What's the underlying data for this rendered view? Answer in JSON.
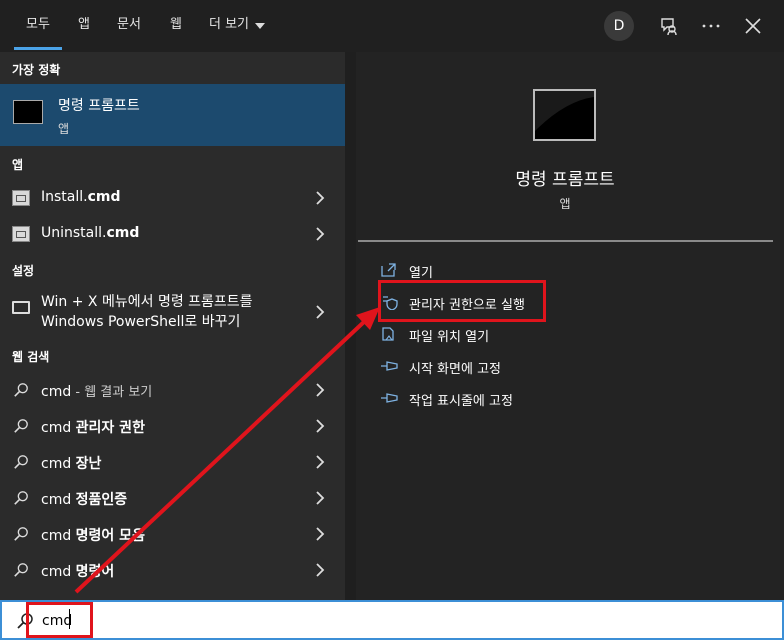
{
  "tabs": [
    {
      "label": "모두",
      "active": true
    },
    {
      "label": "앱"
    },
    {
      "label": "문서"
    },
    {
      "label": "웹"
    },
    {
      "label": "더 보기"
    }
  ],
  "account": {
    "initial": "D"
  },
  "sections": {
    "best_match": "가장 정확",
    "apps": "앱",
    "settings": "설정",
    "web": "웹 검색"
  },
  "best_match": {
    "title": "명령 프롬프트",
    "subtitle": "앱"
  },
  "apps": [
    {
      "name_plain": "Install.",
      "name_bold": "cmd"
    },
    {
      "name_plain": "Uninstall.",
      "name_bold": "cmd"
    }
  ],
  "setting": {
    "line1": "Win + X 메뉴에서 명령 프롬프트를",
    "line2": "Windows PowerShell로 바꾸기"
  },
  "web_results": [
    {
      "query": "cmd",
      "suffix": " - 웹 결과 보기",
      "bold": ""
    },
    {
      "query": "cmd ",
      "suffix": "",
      "bold": "관리자 권한"
    },
    {
      "query": "cmd ",
      "suffix": "",
      "bold": "장난"
    },
    {
      "query": "cmd ",
      "suffix": "",
      "bold": "정품인증"
    },
    {
      "query": "cmd ",
      "suffix": "",
      "bold": "명령어 모음"
    },
    {
      "query": "cmd ",
      "suffix": "",
      "bold": "명령어"
    }
  ],
  "preview": {
    "title": "명령 프롬프트",
    "subtitle": "앱"
  },
  "actions": [
    {
      "label": "열기",
      "icon": "open-icon"
    },
    {
      "label": "관리자 권한으로 실행",
      "icon": "shield-icon"
    },
    {
      "label": "파일 위치 열기",
      "icon": "file-location-icon"
    },
    {
      "label": "시작 화면에 고정",
      "icon": "pin-icon"
    },
    {
      "label": "작업 표시줄에 고정",
      "icon": "pin-icon"
    }
  ],
  "search": {
    "value": "cmd"
  },
  "colors": {
    "accent": "#4ba3e8",
    "annotation": "#e0141c",
    "selected_bg": "#1c4a6e"
  }
}
